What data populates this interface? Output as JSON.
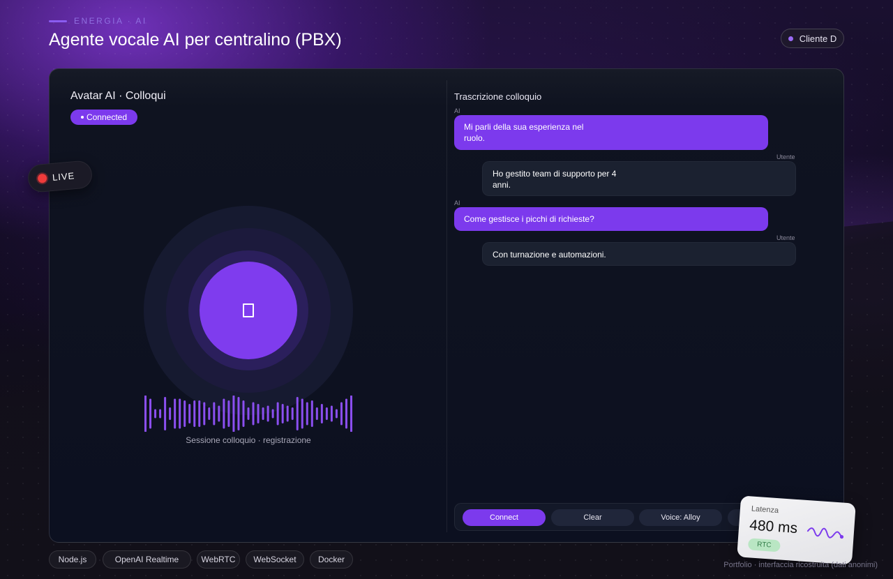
{
  "header": {
    "eyebrow": "ENERGIA · AI",
    "title": "Agente vocale AI per centralino (PBX)",
    "client": "Cliente D"
  },
  "left_panel": {
    "title": "Avatar AI · Colloqui",
    "status": "Connected",
    "live_label": "LIVE",
    "avatar_icon": "device-icon",
    "wave_caption": "Sessione colloquio · registrazione"
  },
  "transcript": {
    "title": "Trascrizione colloquio",
    "messages": [
      {
        "speaker": "AI",
        "line1": "Mi parli della sua esperienza nel",
        "line2": "ruolo."
      },
      {
        "speaker": "Utente",
        "line1": "Ho gestito team di supporto per 4",
        "line2": "anni."
      },
      {
        "speaker": "AI",
        "line1": "Come gestisce i picchi di richieste?"
      },
      {
        "speaker": "Utente",
        "line1": "Con turnazione e automazioni."
      }
    ]
  },
  "controls": {
    "connect": "Connect",
    "clear": "Clear",
    "voice": "Voice: Alloy"
  },
  "latency": {
    "label": "Latenza",
    "value": "480 ms",
    "badge": "RTC"
  },
  "tech_chips": [
    "Node.js",
    "OpenAI Realtime",
    "WebRTC",
    "WebSocket",
    "Docker"
  ],
  "footer_note": "Portfolio · interfaccia ricostruita (dati anonimi)",
  "colors": {
    "accent": "#7c3aed",
    "live": "#ef3b3b",
    "badge_green": "#b9e6c3"
  }
}
